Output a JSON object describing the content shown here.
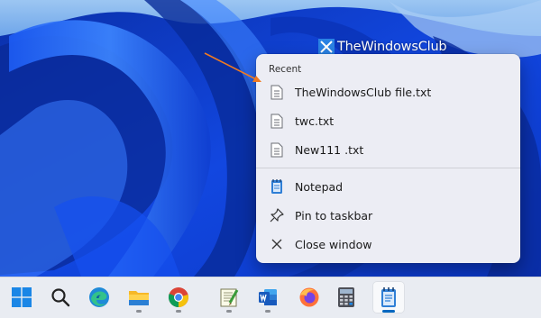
{
  "watermark": {
    "text": "TheWindowsClub"
  },
  "jumplist": {
    "header": "Recent",
    "recent": [
      {
        "label": "TheWindowsClub file.txt",
        "icon": "text-file-icon"
      },
      {
        "label": "twc.txt",
        "icon": "text-file-icon"
      },
      {
        "label": "New111 .txt",
        "icon": "text-file-icon"
      }
    ],
    "tasks": [
      {
        "label": "Notepad",
        "icon": "notepad-icon"
      },
      {
        "label": "Pin to taskbar",
        "icon": "pin-icon"
      },
      {
        "label": "Close window",
        "icon": "close-icon"
      }
    ]
  },
  "taskbar": {
    "icons": [
      {
        "name": "start-button",
        "icon": "windows-logo-icon",
        "running": false
      },
      {
        "name": "search-button",
        "icon": "search-icon",
        "running": false
      },
      {
        "name": "edge-app",
        "icon": "edge-icon",
        "running": false
      },
      {
        "name": "file-explorer-app",
        "icon": "folder-icon",
        "running": true
      },
      {
        "name": "chrome-app",
        "icon": "chrome-icon",
        "running": true
      },
      {
        "name": "notepad-plus-app",
        "icon": "notepad-plus-icon",
        "running": true
      },
      {
        "name": "word-app",
        "icon": "word-icon",
        "running": true
      },
      {
        "name": "firefox-app",
        "icon": "firefox-icon",
        "running": false
      },
      {
        "name": "calculator-app",
        "icon": "calculator-icon",
        "running": false
      },
      {
        "name": "notepad-app",
        "icon": "notepad-icon",
        "running": true,
        "active": true
      }
    ]
  },
  "colors": {
    "wallpaper": "#0b3fd6",
    "arrow": "#f07a20",
    "taskbar": "#e9ecf2",
    "menu": "#ecedf4",
    "accent": "#0067c0"
  }
}
